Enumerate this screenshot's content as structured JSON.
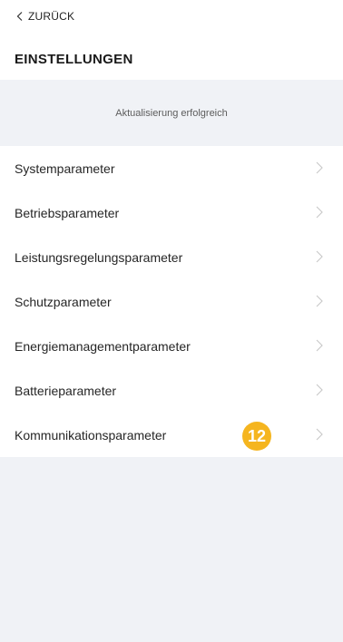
{
  "header": {
    "back_label": "ZURÜCK",
    "title": "EINSTELLUNGEN"
  },
  "notice": {
    "text": "Aktualisierung erfolgreich"
  },
  "menu": {
    "items": [
      {
        "label": "Systemparameter"
      },
      {
        "label": "Betriebsparameter"
      },
      {
        "label": "Leistungsregelungsparameter"
      },
      {
        "label": "Schutzparameter"
      },
      {
        "label": "Energiemanagementparameter"
      },
      {
        "label": "Batterieparameter"
      },
      {
        "label": "Kommunikationsparameter",
        "badge": "12"
      }
    ]
  },
  "icons": {
    "back": "chevron-left-icon",
    "row_arrow": "chevron-right-icon"
  },
  "colors": {
    "badge": "#f5b51f",
    "section_background": "#f0f2f6",
    "arrow": "#c8c8c8"
  }
}
